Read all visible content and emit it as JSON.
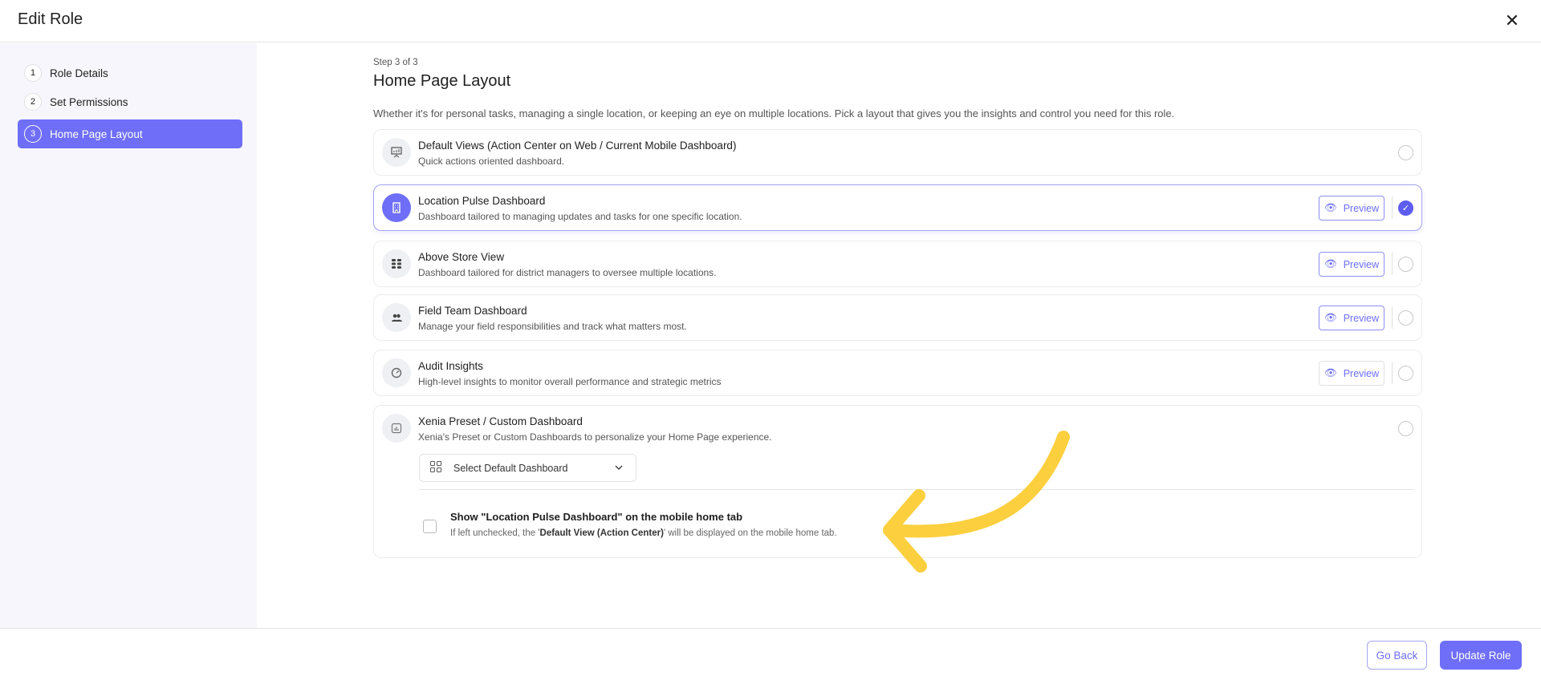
{
  "header": {
    "title": "Edit Role"
  },
  "sidebar": {
    "steps": [
      {
        "num": "1",
        "label": "Role Details"
      },
      {
        "num": "2",
        "label": "Set Permissions"
      },
      {
        "num": "3",
        "label": "Home Page Layout"
      }
    ]
  },
  "main": {
    "step_indicator": "Step 3 of 3",
    "title": "Home Page Layout",
    "description": "Whether it's for personal tasks, managing a single location, or keeping an eye on multiple locations. Pick a layout that gives you the insights and control you need for this role.",
    "preview_label": "Preview",
    "options": [
      {
        "title": "Default Views (Action Center on Web / Current Mobile Dashboard)",
        "desc": "Quick actions oriented dashboard.",
        "selected": false
      },
      {
        "title": "Location Pulse Dashboard",
        "desc": "Dashboard tailored to managing updates and tasks for one specific location.",
        "selected": true
      },
      {
        "title": "Above Store View",
        "desc": "Dashboard tailored for district managers to oversee multiple locations.",
        "selected": false
      },
      {
        "title": "Field Team Dashboard",
        "desc": "Manage your field responsibilities and track what matters most.",
        "selected": false
      },
      {
        "title": "Audit Insights",
        "desc": "High-level insights to monitor overall performance and strategic metrics",
        "selected": false
      },
      {
        "title": "Xenia Preset / Custom Dashboard",
        "desc": "Xenia's Preset or Custom Dashboards to personalize your Home Page experience.",
        "selected": false
      }
    ],
    "dashboard_select": {
      "placeholder": "Select Default Dashboard"
    },
    "mobile_checkbox": {
      "label": "Show \"Location Pulse Dashboard\" on the mobile home tab",
      "hint_pre": "If left unchecked, the '",
      "hint_bold": "Default View (Action Center)",
      "hint_post": "' will be displayed on the mobile home tab.",
      "checked": false
    }
  },
  "footer": {
    "go_back": "Go Back",
    "update_role": "Update Role"
  },
  "colors": {
    "accent": "#6e6ef8",
    "annotation": "#fccf3e"
  }
}
